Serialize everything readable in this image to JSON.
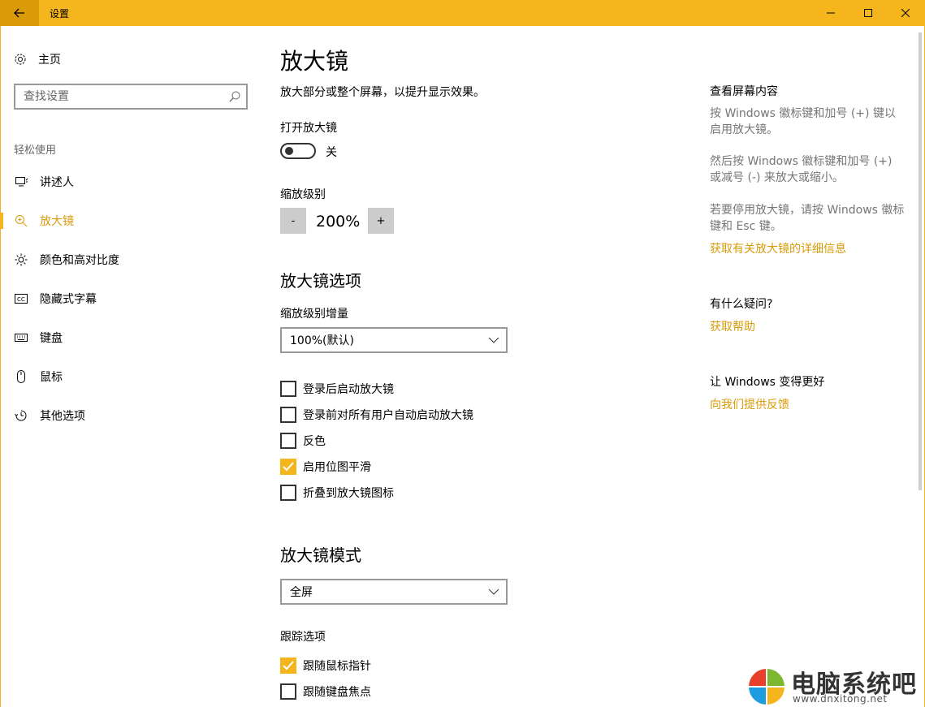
{
  "window": {
    "title": "设置"
  },
  "sidebar": {
    "home_label": "主页",
    "search_placeholder": "查找设置",
    "section_label": "轻松使用",
    "items": [
      {
        "label": "讲述人",
        "icon": "narrator-icon"
      },
      {
        "label": "放大镜",
        "icon": "magnifier-icon",
        "active": true
      },
      {
        "label": "颜色和高对比度",
        "icon": "brightness-icon"
      },
      {
        "label": "隐藏式字幕",
        "icon": "cc-icon"
      },
      {
        "label": "键盘",
        "icon": "keyboard-icon"
      },
      {
        "label": "鼠标",
        "icon": "mouse-icon"
      },
      {
        "label": "其他选项",
        "icon": "other-options-icon"
      }
    ]
  },
  "main": {
    "title": "放大镜",
    "description": "放大部分或整个屏幕，以提升显示效果。",
    "toggle_label": "打开放大镜",
    "toggle_state": "关",
    "zoom_label": "缩放级别",
    "zoom_minus": "-",
    "zoom_value": "200%",
    "zoom_plus": "+",
    "options_heading": "放大镜选项",
    "increment_label": "缩放级别增量",
    "increment_value": "100%(默认)",
    "checkboxes": [
      {
        "label": "登录后启动放大镜",
        "checked": false
      },
      {
        "label": "登录前对所有用户自动启动放大镜",
        "checked": false
      },
      {
        "label": "反色",
        "checked": false
      },
      {
        "label": "启用位图平滑",
        "checked": true
      },
      {
        "label": "折叠到放大镜图标",
        "checked": false
      }
    ],
    "mode_heading": "放大镜模式",
    "mode_value": "全屏",
    "tracking_label": "跟踪选项",
    "tracking": [
      {
        "label": "跟随鼠标指针",
        "checked": true
      },
      {
        "label": "跟随键盘焦点",
        "checked": false
      }
    ]
  },
  "aside": {
    "view_heading": "查看屏幕内容",
    "view_p1": "按 Windows 徽标键和加号 (+) 键以启用放大镜。",
    "view_p2": "然后按 Windows 徽标键和加号 (+) 或减号 (-) 来放大或缩小。",
    "view_p3": "若要停用放大镜，请按 Windows 徽标键和 Esc 键。",
    "view_link": "获取有关放大镜的详细信息",
    "question_heading": "有什么疑问?",
    "question_link": "获取帮助",
    "feedback_heading": "让 Windows 变得更好",
    "feedback_link": "向我们提供反馈"
  },
  "watermark": {
    "title": "电脑系统吧",
    "url": "www.dnxitong.net"
  },
  "colors": {
    "accent": "#f5b51c",
    "accent_dark": "#d99b07",
    "link": "#d99b07"
  }
}
